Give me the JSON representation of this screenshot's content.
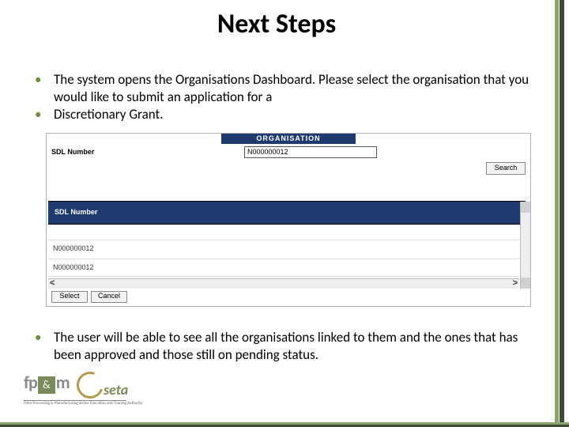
{
  "title": "Next Steps",
  "bullets_top": [
    "The system opens the Organisations Dashboard.  Please select the organisation that you would like to submit an application for a",
    "Discretionary Grant."
  ],
  "bullets_bottom": [
    "The user will be able to see all the organisations linked to them and the ones that has been approved and those still on pending status."
  ],
  "screenshot": {
    "header": "ORGANISATION",
    "search_label": "SDL Number",
    "search_value": "N000000012",
    "search_button": "Search",
    "band_header": "SDL Number",
    "rows": [
      "N000000012",
      "N000000012"
    ],
    "select_button": "Select",
    "cancel_button": "Cancel"
  },
  "logo": {
    "fp": "fp",
    "amp": "&",
    "m": "m",
    "seta": "seta",
    "sub": "Fibre Processing & Manufacturing Sector Education and Training Authority"
  }
}
